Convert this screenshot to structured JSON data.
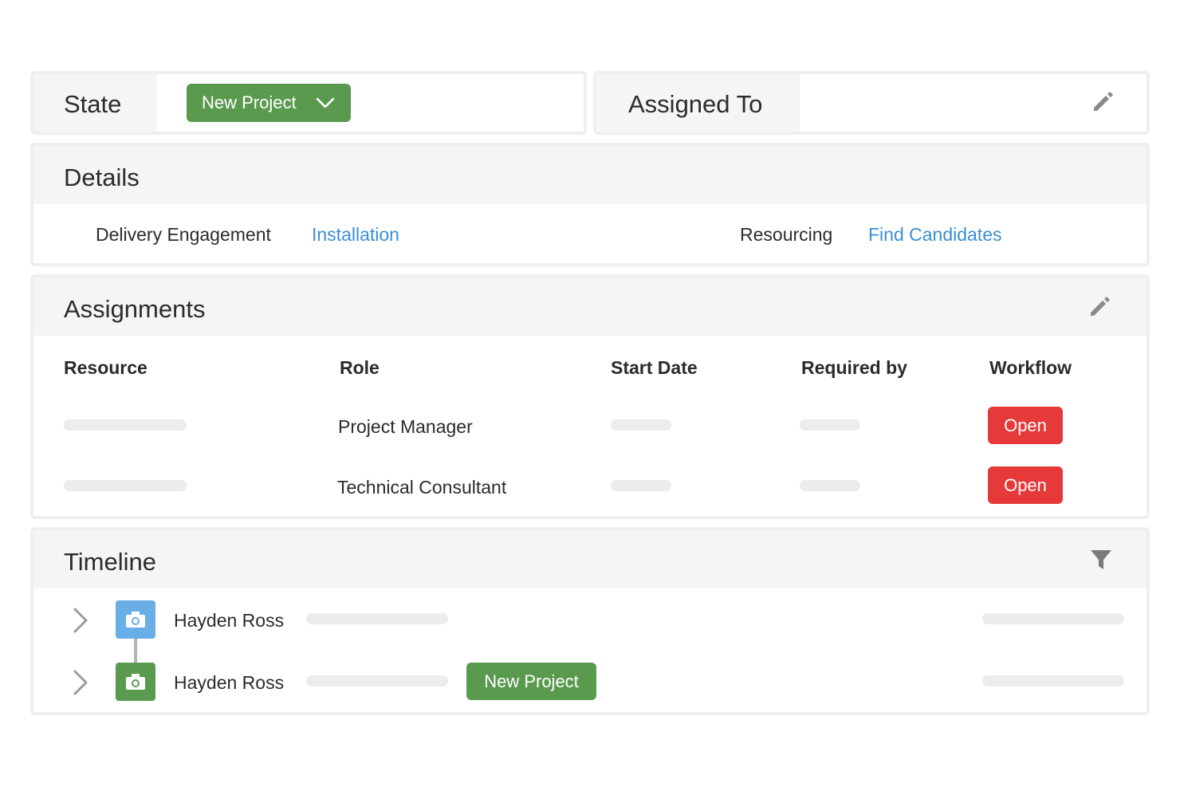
{
  "state": {
    "label": "State",
    "value": "New Project"
  },
  "assigned": {
    "label": "Assigned To"
  },
  "details": {
    "title": "Details",
    "delivery_label": "Delivery Engagement",
    "delivery_value": "Installation",
    "resourcing_label": "Resourcing",
    "resourcing_value": "Find Candidates"
  },
  "assignments": {
    "title": "Assignments",
    "columns": [
      "Resource",
      "Role",
      "Start Date",
      "Required by",
      "Workflow"
    ],
    "rows": [
      {
        "role": "Project Manager",
        "workflow": "Open"
      },
      {
        "role": "Technical Consultant",
        "workflow": "Open"
      }
    ]
  },
  "timeline": {
    "title": "Timeline",
    "items": [
      {
        "name": "Hayden Ross",
        "icon": "camera-icon"
      },
      {
        "name": "Hayden Ross",
        "icon": "camera-icon",
        "badge": "New Project"
      }
    ]
  },
  "colors": {
    "green": "#5a9a4f",
    "blue": "#6aaee8",
    "red": "#e63a3a",
    "link": "#3a8fd6"
  }
}
